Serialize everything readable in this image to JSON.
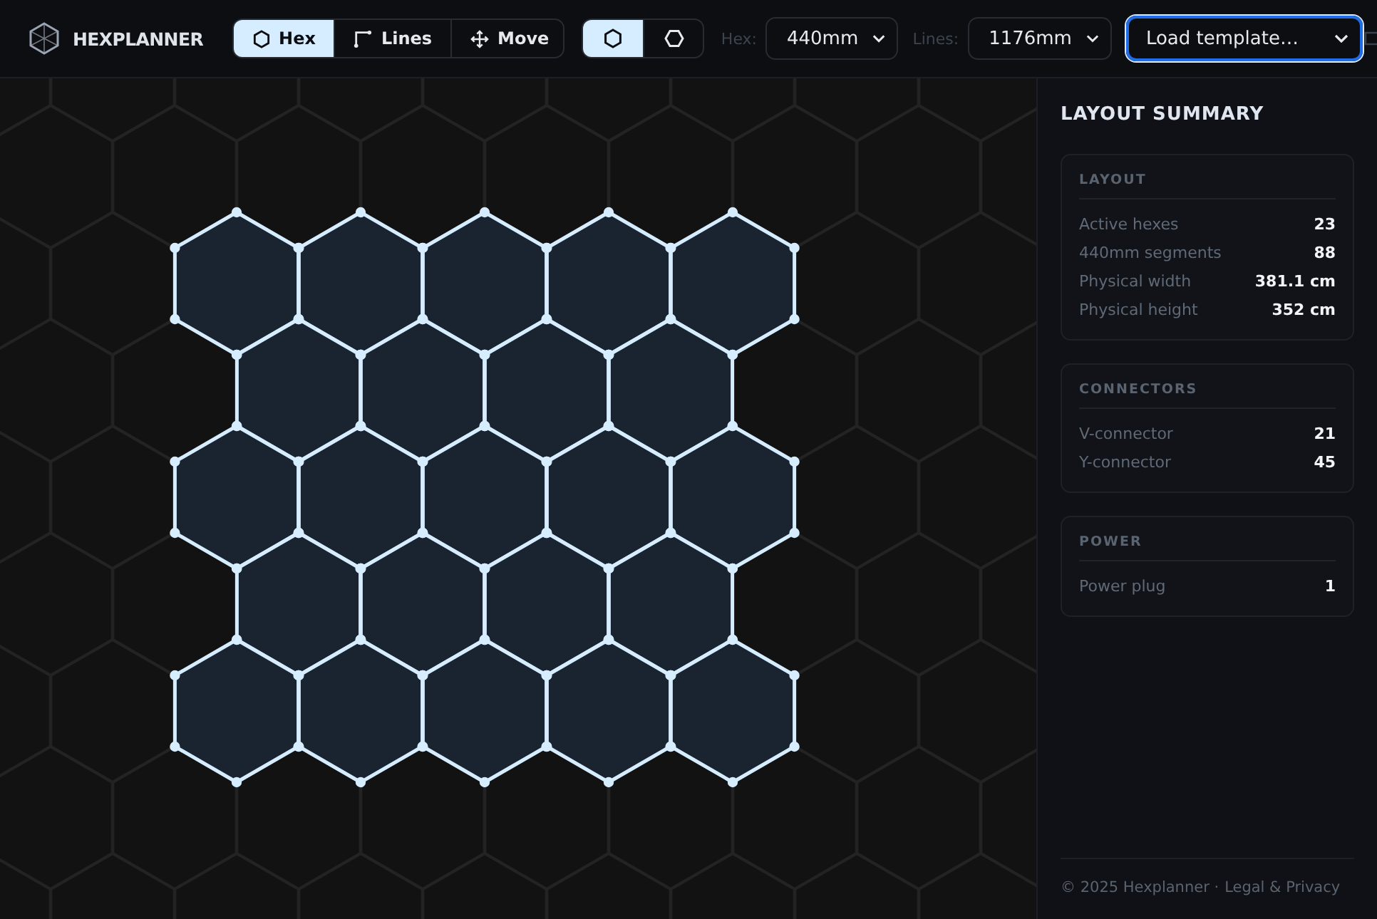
{
  "app": {
    "name": "HEXPLANNER"
  },
  "modes": [
    {
      "label": "Hex",
      "kind": "hex",
      "selected": true
    },
    {
      "label": "Lines",
      "kind": "lines",
      "selected": false
    },
    {
      "label": "Move",
      "kind": "move",
      "selected": false
    }
  ],
  "orientations": [
    {
      "kind": "pointy",
      "selected": true
    },
    {
      "kind": "flat",
      "selected": false
    }
  ],
  "selects": [
    {
      "label": "Hex:",
      "value": "440mm",
      "focused": false
    },
    {
      "label": "Lines:",
      "value": "1176mm",
      "focused": false
    },
    {
      "value": "Load template…",
      "focused": true
    }
  ],
  "summary": {
    "title": "LAYOUT SUMMARY",
    "sections": [
      {
        "title": "LAYOUT",
        "rows": [
          {
            "label": "Active hexes",
            "value": "23"
          },
          {
            "label": "440mm segments",
            "value": "88"
          },
          {
            "label": "Physical width",
            "value": "381.1 cm"
          },
          {
            "label": "Physical height",
            "value": "352 cm"
          }
        ]
      },
      {
        "title": "CONNECTORS",
        "rows": [
          {
            "label": "V-connector",
            "value": "21"
          },
          {
            "label": "Y-connector",
            "value": "45"
          }
        ]
      },
      {
        "title": "POWER",
        "rows": [
          {
            "label": "Power plug",
            "value": "1"
          }
        ]
      }
    ]
  },
  "footer": {
    "text": "© 2025 Hexplanner ·",
    "link": "Legal & Privacy"
  }
}
